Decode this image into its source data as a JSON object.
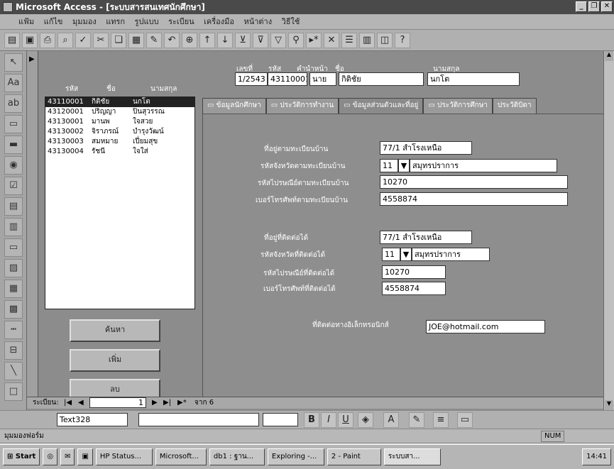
{
  "window": {
    "title": "Microsoft Access - [ระบบสารสนเทศนักศึกษา]"
  },
  "menu": [
    "แฟ้ม",
    "แก้ไข",
    "มุมมอง",
    "แทรก",
    "รูปแบบ",
    "ระเบียน",
    "เครื่องมือ",
    "หน้าต่าง",
    "วิธีใช้"
  ],
  "header": {
    "col_code": "รหัส",
    "col_name": "ชื่อ",
    "col_surname": "นามสกุล",
    "lbl_seq": "เลขที่",
    "lbl_code": "รหัส",
    "lbl_prefix": "คำนำหน้า",
    "lbl_name": "ชื่อ",
    "lbl_surname": "นามสกุล",
    "val_seq": "1/2543",
    "val_code": "43110001",
    "val_prefix": "นาย",
    "val_name": "กิติชัย",
    "val_surname": "นกโต"
  },
  "list": [
    {
      "code": "43110001",
      "name": "กิติชัย",
      "surname": "นกโต"
    },
    {
      "code": "43120001",
      "name": "ปริญญา",
      "surname": "ปิ่นสุวรรณ"
    },
    {
      "code": "43130001",
      "name": "มานพ",
      "surname": "ใจสวย"
    },
    {
      "code": "43130002",
      "name": "จิราภรณ์",
      "surname": "บำรุงวัฒน์"
    },
    {
      "code": "43130003",
      "name": "สมหมาย",
      "surname": "เปี่ยมสุข"
    },
    {
      "code": "43130004",
      "name": "รัชนี",
      "surname": "ใจใส่"
    }
  ],
  "buttons": {
    "search": "ค้นหา",
    "add": "เพิ่ม",
    "delete": "ลบ"
  },
  "tabs": [
    "ข้อมูลนักศึกษา",
    "ประวัติการทำงาน",
    "ข้อมูลส่วนตัวและที่อยู่",
    "ประวัติการศึกษา",
    "ประวัติบิดา"
  ],
  "fields": {
    "addr_home_lbl": "ที่อยู่ตามทะเบียนบ้าน",
    "addr_home": "77/1 สำโรงเหนือ",
    "prov_home_lbl": "รหัสจังหวัดตามทะเบียนบ้าน",
    "prov_home_code": "11",
    "prov_home_name": "สมุทรปราการ",
    "zip_home_lbl": "รหัสไปรษณีย์ตามทะเบียนบ้าน",
    "zip_home": "10270",
    "tel_home_lbl": "เบอร์โทรศัพท์ตามทะเบียนบ้าน",
    "tel_home": "4558874",
    "addr_cont_lbl": "ที่อยู่ที่ติดต่อได้",
    "addr_cont": "77/1 สำโรงเหนือ",
    "prov_cont_lbl": "รหัสจังหวัดที่ติดต่อได้",
    "prov_cont_code": "11",
    "prov_cont_name": "สมุทรปราการ",
    "zip_cont_lbl": "รหัสไปรษณีย์ที่ติดต่อได้",
    "zip_cont": "10270",
    "tel_cont_lbl": "เบอร์โทรศัพท์ที่ติดต่อได้",
    "tel_cont": "4558874",
    "email_lbl": "ที่ติดต่อทางอิเล็กทรอนิกส์",
    "email": "JOE@hotmail.com"
  },
  "nav": {
    "label": "ระเบียน:",
    "current": "1",
    "total_text": "จาก 6"
  },
  "format": {
    "control": "Text328"
  },
  "status": {
    "text": "มุมมองฟอร์ม",
    "num": "NUM"
  },
  "taskbar": {
    "start": "Start",
    "tasks": [
      "HP Status...",
      "Microsoft...",
      "db1 : ฐาน...",
      "Exploring -...",
      "2 - Paint",
      "ระบบสา..."
    ],
    "time": "14:41"
  }
}
